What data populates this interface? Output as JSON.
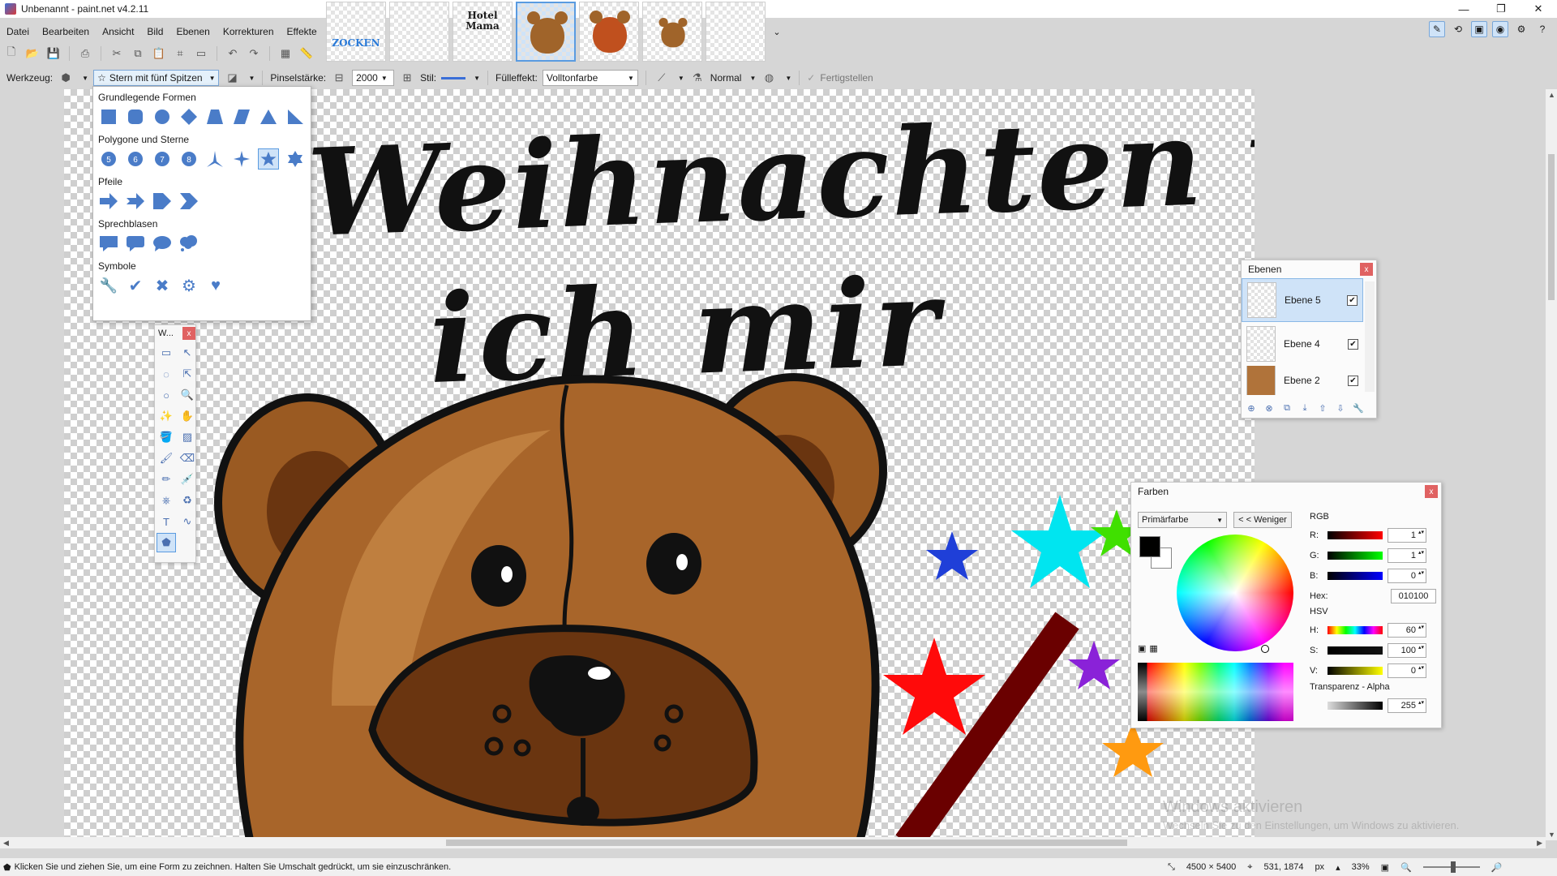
{
  "window": {
    "title": "Unbenannt - paint.net v4.2.11",
    "controls": [
      "—",
      "❐",
      "✕"
    ]
  },
  "menu": [
    "Datei",
    "Bearbeiten",
    "Ansicht",
    "Bild",
    "Ebenen",
    "Korrekturen",
    "Effekte"
  ],
  "image_tabs": {
    "thumb1_text": "ZOCKEN",
    "thumb3_text": "Hotel Mama",
    "more_arrow": "⌄"
  },
  "toolbar2": {
    "tool_label": "Werkzeug:",
    "shape_label": "Stern mit fünf Spitzen",
    "brush_label": "Pinselstärke:",
    "brush_value": "2000",
    "style_label": "Stil:",
    "fill_label": "Fülleffekt:",
    "fill_value": "Volltonfarbe",
    "blend_value": "Normal",
    "finish_label": "Fertigstellen"
  },
  "shape_panel": {
    "categories": [
      {
        "name": "Grundlegende Formen",
        "glyphs": [
          "■",
          "▢",
          "●",
          "◆",
          "⏢",
          "▱",
          "▲",
          "◣"
        ]
      },
      {
        "name": "Polygone und Sterne",
        "glyphs": [
          "5",
          "6",
          "7",
          "8",
          "✦",
          "✧",
          "★",
          "✹"
        ]
      },
      {
        "name": "Pfeile",
        "glyphs": [
          "➡",
          "➧",
          "▶",
          "❯"
        ]
      },
      {
        "name": "Sprechblasen",
        "glyphs": [
          "💬",
          "🗨",
          "💭",
          "☁"
        ]
      },
      {
        "name": "Symbole",
        "glyphs": [
          "⚲",
          "✔",
          "✖",
          "⚙",
          "♥"
        ]
      }
    ],
    "selected_index": 6
  },
  "tools_window": {
    "title": "W...",
    "close": "x"
  },
  "layers": {
    "title": "Ebenen",
    "close": "x",
    "items": [
      {
        "name": "Ebene 5",
        "checked": "✔"
      },
      {
        "name": "Ebene 4",
        "checked": "✔"
      },
      {
        "name": "Ebene 2",
        "checked": "✔"
      }
    ]
  },
  "colors": {
    "title": "Farben",
    "close": "x",
    "mode": "Primärfarbe",
    "less_button": "< < Weniger",
    "rgb_label": "RGB",
    "r_label": "R:",
    "r_value": "1",
    "g_label": "G:",
    "g_value": "1",
    "b_label": "B:",
    "b_value": "0",
    "hex_label": "Hex:",
    "hex_value": "010100",
    "hsv_label": "HSV",
    "h_label": "H:",
    "h_value": "60",
    "s_label": "S:",
    "s_value": "100",
    "v_label": "V:",
    "v_value": "0",
    "alpha_label": "Transparenz - Alpha",
    "alpha_value": "255",
    "primary_color": "#010100"
  },
  "canvas": {
    "line1": "Weihnachten wünsche",
    "line2": "ich mir"
  },
  "status": {
    "message": "Klicken Sie und ziehen Sie, um eine Form zu zeichnen. Halten Sie Umschalt gedrückt, um sie einzuschränken.",
    "image_size": "4500 × 5400",
    "cursor_pos": "531, 1874",
    "unit": "px",
    "zoom": "33%"
  },
  "watermark": {
    "line1": "Windows aktivieren",
    "line2": "Wechseln Sie zu den Einstellungen, um Windows zu aktivieren."
  }
}
